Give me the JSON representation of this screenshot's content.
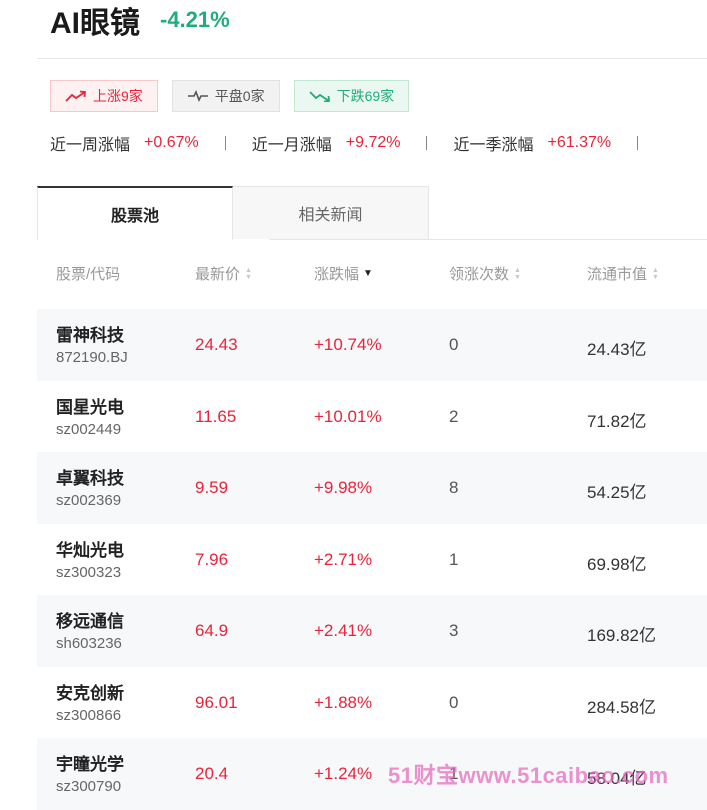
{
  "sector": {
    "name": "AI眼镜",
    "change": "-4.21%"
  },
  "badges": {
    "up": {
      "label": "上涨9家",
      "icon": "trend-up-icon",
      "color": "#e8243a"
    },
    "flat": {
      "label": "平盘0家",
      "icon": "pulse-flat-icon",
      "color": "#555555"
    },
    "down": {
      "label": "下跌69家",
      "icon": "trend-down-icon",
      "color": "#1fad7c"
    }
  },
  "performance": [
    {
      "label": "近一周涨幅",
      "value": "+0.67%"
    },
    {
      "label": "近一月涨幅",
      "value": "+9.72%"
    },
    {
      "label": "近一季涨幅",
      "value": "+61.37%"
    }
  ],
  "tabs": [
    {
      "label": "股票池",
      "active": true
    },
    {
      "label": "相关新闻",
      "active": false
    }
  ],
  "table": {
    "headers": {
      "name": "股票/代码",
      "price": "最新价",
      "change": "涨跌幅",
      "lead": "领涨次数",
      "cap": "流通市值"
    },
    "sorted_by": "change",
    "sort_direction": "desc",
    "rows": [
      {
        "name": "雷神科技",
        "code": "872190.BJ",
        "price": "24.43",
        "change": "+10.74%",
        "lead": "0",
        "cap": "24.43亿"
      },
      {
        "name": "国星光电",
        "code": "sz002449",
        "price": "11.65",
        "change": "+10.01%",
        "lead": "2",
        "cap": "71.82亿"
      },
      {
        "name": "卓翼科技",
        "code": "sz002369",
        "price": "9.59",
        "change": "+9.98%",
        "lead": "8",
        "cap": "54.25亿"
      },
      {
        "name": "华灿光电",
        "code": "sz300323",
        "price": "7.96",
        "change": "+2.71%",
        "lead": "1",
        "cap": "69.98亿"
      },
      {
        "name": "移远通信",
        "code": "sh603236",
        "price": "64.9",
        "change": "+2.41%",
        "lead": "3",
        "cap": "169.82亿"
      },
      {
        "name": "安克创新",
        "code": "sz300866",
        "price": "96.01",
        "change": "+1.88%",
        "lead": "0",
        "cap": "284.58亿"
      },
      {
        "name": "宇瞳光学",
        "code": "sz300790",
        "price": "20.4",
        "change": "+1.24%",
        "lead": "1",
        "cap": "58.04亿"
      }
    ]
  },
  "colors": {
    "rise": "#e8243a",
    "fall": "#1fad7c"
  },
  "watermark": "51财宝www.51caibao.com"
}
